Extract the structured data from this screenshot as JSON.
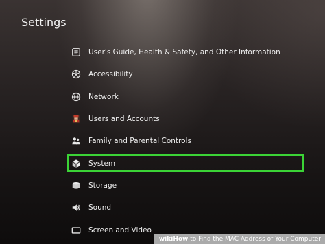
{
  "page": {
    "title": "Settings"
  },
  "menu": {
    "items": [
      {
        "label": "User's Guide, Health & Safety, and Other Information",
        "icon": "info-icon"
      },
      {
        "label": "Accessibility",
        "icon": "accessibility-icon"
      },
      {
        "label": "Network",
        "icon": "globe-icon"
      },
      {
        "label": "Users and Accounts",
        "icon": "user-avatar-icon"
      },
      {
        "label": "Family and Parental Controls",
        "icon": "family-icon"
      },
      {
        "label": "System",
        "icon": "cube-icon",
        "highlighted": true
      },
      {
        "label": "Storage",
        "icon": "storage-icon"
      },
      {
        "label": "Sound",
        "icon": "speaker-icon"
      },
      {
        "label": "Screen and Video",
        "icon": "screen-icon"
      }
    ]
  },
  "highlight": {
    "color": "#3bd336"
  },
  "watermark": {
    "brand_bold": "wiki",
    "brand_rest": "How",
    "text": " to Find the MAC Address of Your Computer"
  }
}
